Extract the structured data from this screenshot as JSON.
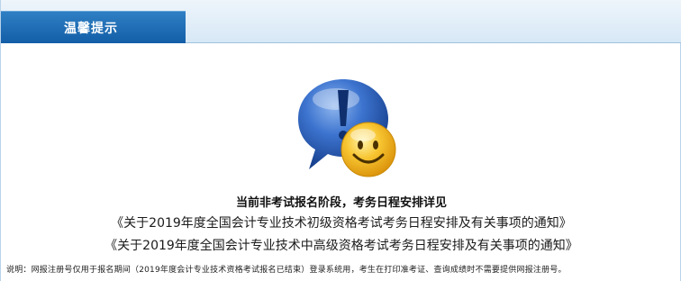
{
  "header": {
    "title": "温馨提示"
  },
  "icon": {
    "name": "question-bubble-smiley-icon"
  },
  "message": {
    "main": "当前非考试报名阶段，考务日程安排详见",
    "links": [
      "《关于2019年度全国会计专业技术初级资格考试考务日程安排及有关事项的通知》",
      "《关于2019年度全国会计专业技术中高级资格考试考务日程安排及有关事项的通知》"
    ]
  },
  "note": "说明：网报注册号仅用于报名期间（2019年度会计专业技术资格考试报名已结束）登录系统用，考生在打印准考证、查询成绩时不需要提供网报注册号。",
  "colors": {
    "header_tab": "#1f6db6",
    "header_strip": "#e3eef8",
    "bubble_blue": "#2a5fc0",
    "smiley_yellow": "#f3b51c"
  }
}
